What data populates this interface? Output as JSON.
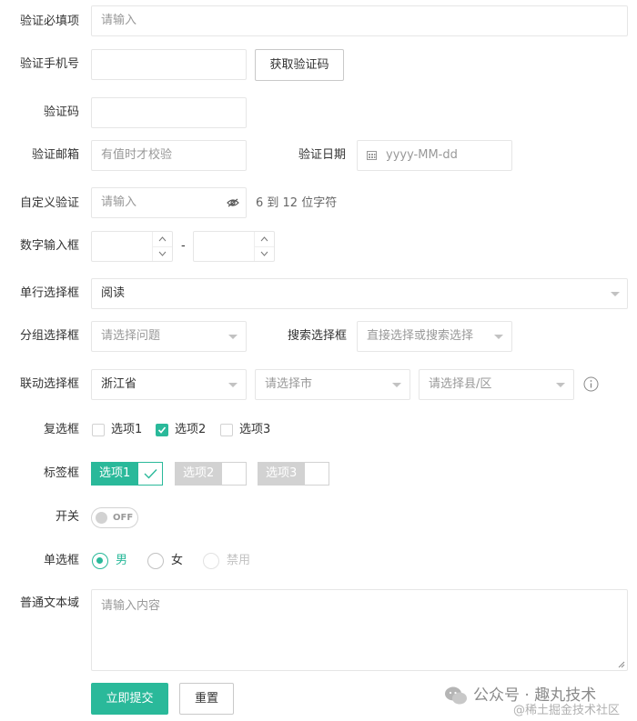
{
  "colors": {
    "primary": "#2ab99a",
    "border": "#e6e6e6",
    "placeholder": "#999999",
    "tag_off": "#d2d2d2"
  },
  "fields": {
    "required": {
      "label": "验证必填项",
      "placeholder": "请输入"
    },
    "phone": {
      "label": "验证手机号",
      "value": "",
      "button": "获取验证码"
    },
    "code": {
      "label": "验证码",
      "value": ""
    },
    "email": {
      "label": "验证邮箱",
      "placeholder": "有值时才校验"
    },
    "date": {
      "label": "验证日期",
      "placeholder": "yyyy-MM-dd",
      "icon": "calendar-icon"
    },
    "custom": {
      "label": "自定义验证",
      "placeholder": "请输入",
      "hint": "6 到 12 位字符",
      "icon": "eye-icon"
    },
    "number": {
      "label": "数字输入框",
      "separator": "-",
      "min": "",
      "max": ""
    },
    "single_select": {
      "label": "单行选择框",
      "value": "阅读"
    },
    "group_select": {
      "label": "分组选择框",
      "placeholder": "请选择问题"
    },
    "search_select": {
      "label": "搜索选择框",
      "placeholder": "直接选择或搜索选择"
    },
    "cascade": {
      "label": "联动选择框",
      "province": "浙江省",
      "city_placeholder": "请选择市",
      "district_placeholder": "请选择县/区",
      "icon": "info-icon"
    },
    "checkbox": {
      "label": "复选框",
      "options": [
        {
          "label": "选项1",
          "checked": false
        },
        {
          "label": "选项2",
          "checked": true
        },
        {
          "label": "选项3",
          "checked": false
        }
      ]
    },
    "tags": {
      "label": "标签框",
      "options": [
        {
          "label": "选项1",
          "checked": true
        },
        {
          "label": "选项2",
          "checked": false
        },
        {
          "label": "选项3",
          "checked": false
        }
      ]
    },
    "switch": {
      "label": "开关",
      "state": "OFF"
    },
    "radio": {
      "label": "单选框",
      "options": [
        {
          "label": "男",
          "checked": true,
          "disabled": false
        },
        {
          "label": "女",
          "checked": false,
          "disabled": false
        },
        {
          "label": "禁用",
          "checked": false,
          "disabled": true
        }
      ]
    },
    "textarea": {
      "label": "普通文本域",
      "placeholder": "请输入内容"
    }
  },
  "actions": {
    "submit": "立即提交",
    "reset": "重置"
  },
  "watermark": {
    "text": "公众号 · 趣丸技术",
    "sub": "@稀土掘金技术社区"
  }
}
